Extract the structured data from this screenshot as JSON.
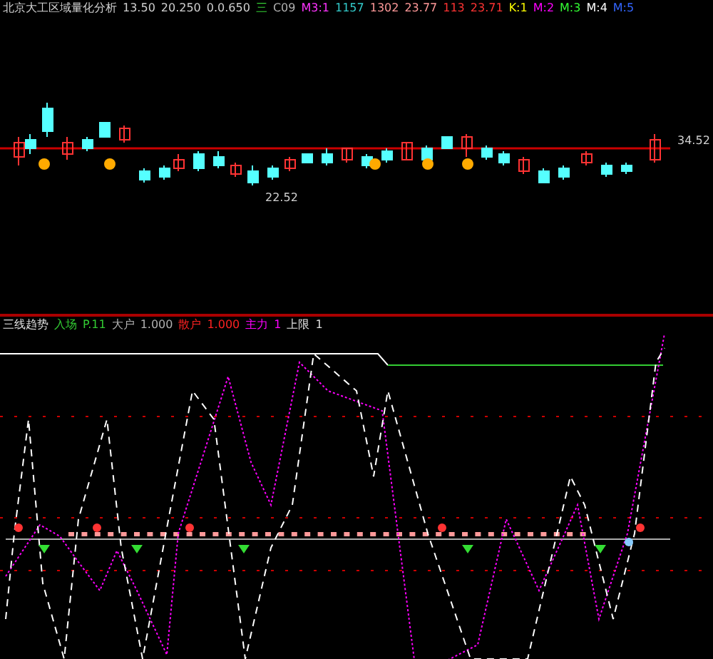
{
  "header": {
    "title": "北京大工区域量化分析",
    "items": [
      {
        "text": "13.50",
        "color": "#d0d0d0"
      },
      {
        "text": "20.250",
        "color": "#d0d0d0"
      },
      {
        "text": "0.0.650",
        "color": "#d0d0d0"
      },
      {
        "text": "三",
        "color": "#33cc33"
      },
      {
        "text": "C09",
        "color": "#b0b0b0"
      },
      {
        "text": "M3:1",
        "color": "#ff33ff"
      },
      {
        "text": "1157",
        "color": "#33cccc"
      },
      {
        "text": "1302",
        "color": "#ff9999"
      },
      {
        "text": "23.77",
        "color": "#ff9999"
      },
      {
        "text": "113",
        "color": "#ff3333"
      },
      {
        "text": "23.71",
        "color": "#ff3333"
      },
      {
        "text": "K:1",
        "color": "#ffff00"
      },
      {
        "text": "M:2",
        "color": "#ff00ff"
      },
      {
        "text": "M:3",
        "color": "#33ff33"
      },
      {
        "text": "M:4",
        "color": "#ffffff"
      },
      {
        "text": "M:5",
        "color": "#3366ff"
      }
    ]
  },
  "price_chart": {
    "high_label": "34.52",
    "low_label": "22.52"
  },
  "indicator": {
    "title": "三线趋势",
    "items": [
      {
        "text": "入场",
        "color": "#33cc33"
      },
      {
        "text": "P.11",
        "color": "#33cc33"
      },
      {
        "text": "大户",
        "color": "#b0b0b0"
      },
      {
        "text": "1.000",
        "color": "#b0b0b0"
      },
      {
        "text": "散户",
        "color": "#ff2222"
      },
      {
        "text": "1.000",
        "color": "#ff2222"
      },
      {
        "text": "主力",
        "color": "#ff00ff"
      },
      {
        "text": "1",
        "color": "#ff00ff"
      },
      {
        "text": "上限",
        "color": "#e0e0e0"
      },
      {
        "text": "1",
        "color": "#e0e0e0"
      }
    ]
  }
}
